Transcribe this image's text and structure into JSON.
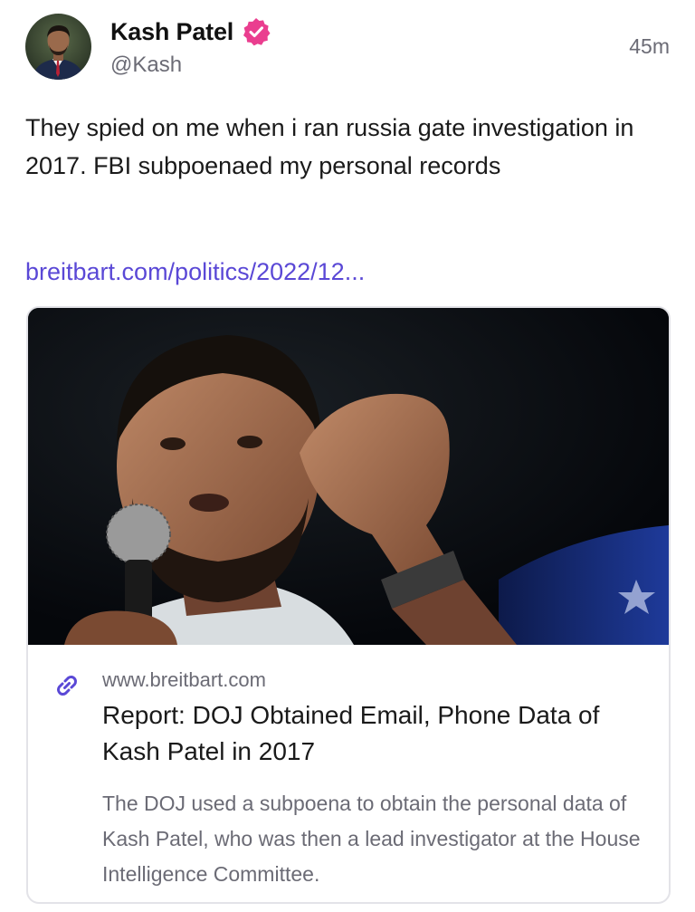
{
  "author": {
    "display_name": "Kash Patel",
    "handle": "@Kash",
    "verified_icon": "verified-badge-icon",
    "verified_color": "#ea3e8f"
  },
  "post": {
    "timestamp": "45m",
    "text": "They spied on me when i ran russia gate investigation in 2017. FBI subpoenaed my personal records",
    "link_text": "breitbart.com/politics/2022/12...",
    "link_color": "#5a48d6"
  },
  "link_card": {
    "image_alt": "Man speaking into a microphone with raised fist",
    "link_icon": "link-icon",
    "link_icon_color": "#5a48d6",
    "domain": "www.breitbart.com",
    "title": "Report: DOJ Obtained Email, Phone Data of Kash Patel in 2017",
    "description": "The DOJ used a subpoena to obtain the personal data of Kash Patel, who was then a lead investigator at the House Intelligence Committee."
  }
}
